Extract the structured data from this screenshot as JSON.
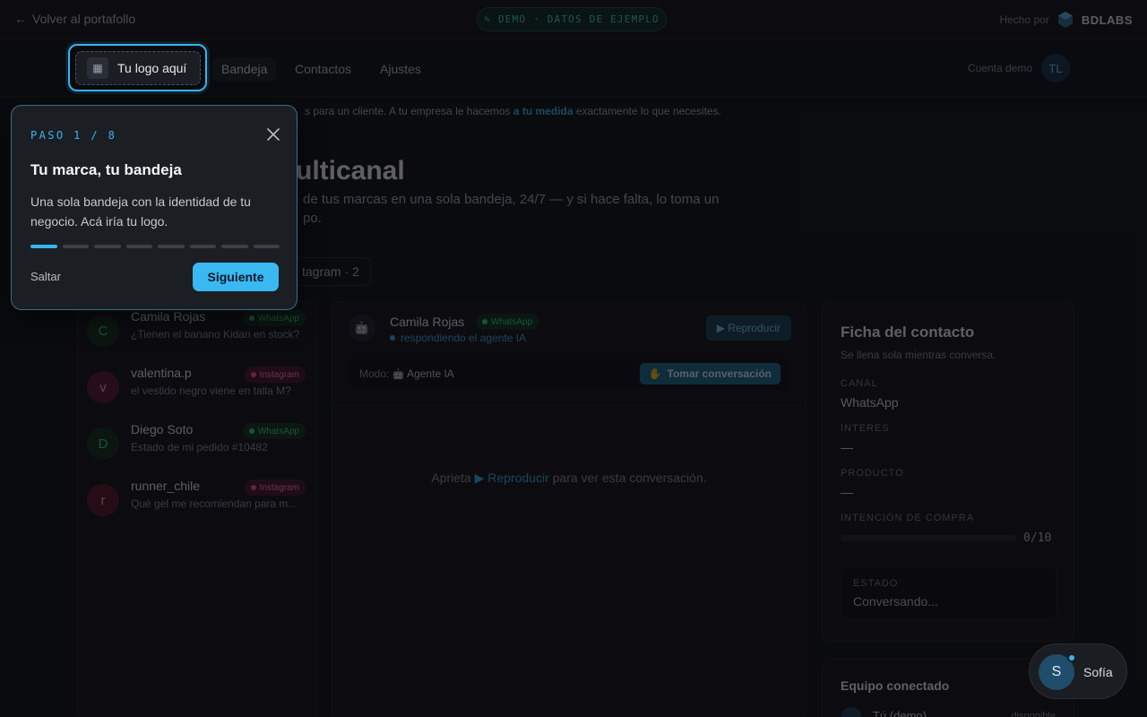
{
  "topbar": {
    "back_label": "Volver al portafollo",
    "demo_label": "DEMO · DATOS DE EJEMPLO",
    "made_by": "Hecho por",
    "brand": "BDLABS"
  },
  "nav": {
    "logo_label": "Tu logo aquí",
    "tabs": [
      {
        "label": "Bandeja"
      },
      {
        "label": "Contactos"
      },
      {
        "label": "Ajustes"
      }
    ],
    "account_label": "Cuenta demo",
    "account_initials": "TL"
  },
  "banner": {
    "text_before": "s para un cliente. A tu empresa le hacemos ",
    "highlight": "a tu medida",
    "text_after": " exactamente lo que necesites."
  },
  "hero": {
    "title": "ulticanal",
    "subtitle": "de tus marcas en una sola bandeja, 24/7 — y si hace falta, lo toma un po.",
    "filter_chip": "tagram · 2"
  },
  "conversations": [
    {
      "initial": "C",
      "name": "Camila Rojas",
      "preview": "¿Tienen el banano Kidan en stock?",
      "channel": "WhatsApp",
      "color": "#1f5a3a"
    },
    {
      "initial": "v",
      "name": "valentina.p",
      "preview": "el vestido negro viene en talla M?",
      "channel": "Instagram",
      "color": "#6a1d48"
    },
    {
      "initial": "D",
      "name": "Diego Soto",
      "preview": "Estado de mi pedido #10482",
      "channel": "WhatsApp",
      "color": "#1f5a3a"
    },
    {
      "initial": "r",
      "name": "runner_chile",
      "preview": "Qué gel me recomiendan para m...",
      "channel": "Instagram",
      "color": "#6a1d30"
    }
  ],
  "chat": {
    "name": "Camila Rojas",
    "channel": "WhatsApp",
    "status": "respondiendo el agente IA",
    "play_label": "▶ Reproducir",
    "mode_prefix": "Modo:",
    "mode_value": "Agente IA",
    "take_label": "Tomar conversación",
    "empty_before": "Aprieta ",
    "empty_link": "▶ Reproducir",
    "empty_after": " para ver esta conversación."
  },
  "contact": {
    "title": "Ficha del contacto",
    "subtitle": "Se llena sola mientras conversa.",
    "fields": [
      {
        "label": "CANAL",
        "value": "WhatsApp"
      },
      {
        "label": "INTERES",
        "value": "—"
      },
      {
        "label": "PRODUCTO",
        "value": "—"
      }
    ],
    "intent_label": "INTENCIÓN DE COMPRA",
    "intent_value": "0/10",
    "intent_fraction": 0,
    "estado_label": "ESTADO",
    "estado_value": "Conversando..."
  },
  "team": {
    "title": "Equipo conectado",
    "you": "Tú (demo)",
    "state": "disponible"
  },
  "tour": {
    "step": "PASO 1 / 8",
    "title": "Tu marca, tu bandeja",
    "body": "Una sola bandeja con la identidad de tu negocio. Acá iría tu logo.",
    "current": 1,
    "total": 8,
    "skip": "Saltar",
    "next": "Siguiente"
  },
  "agent": {
    "initial": "S",
    "name": "Sofía"
  },
  "colors": {
    "accent": "#39b4f0",
    "whatsapp": "#3ecf78",
    "instagram": "#ff5a6a"
  }
}
